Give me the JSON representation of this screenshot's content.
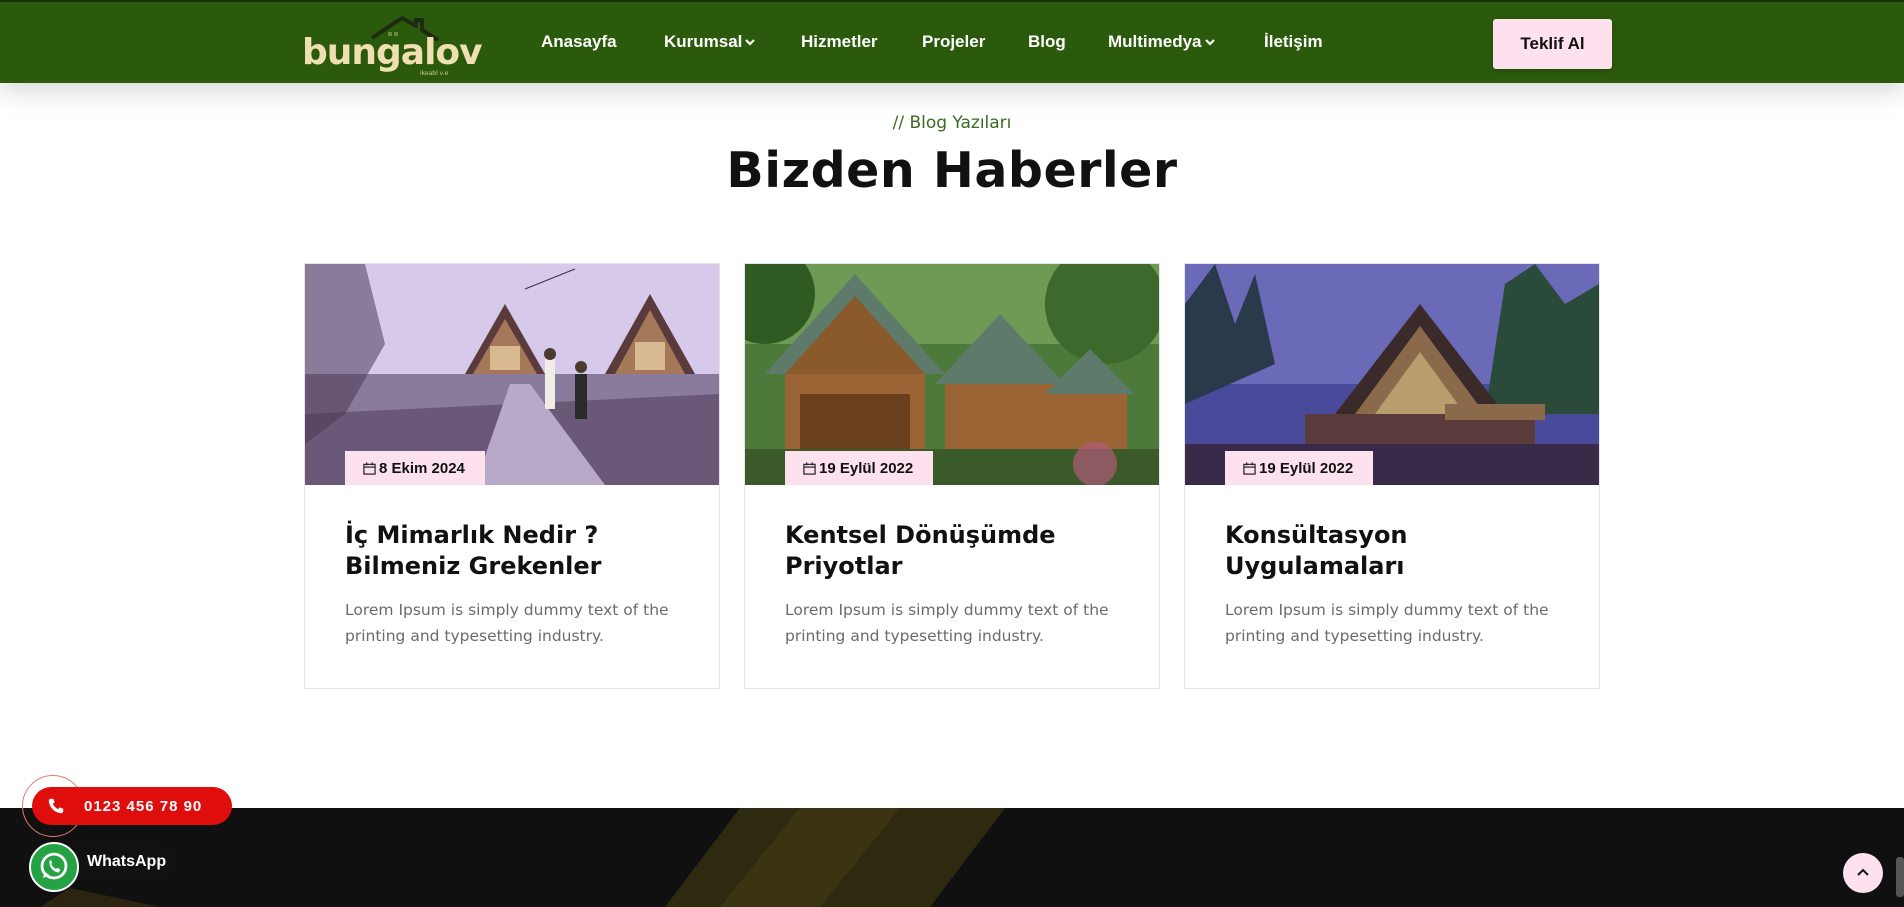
{
  "brand": {
    "name": "bungalov",
    "tagline": "ikeabl v.e"
  },
  "nav": {
    "items": [
      {
        "label": "Anasayfa"
      },
      {
        "label": "Kurumsal",
        "dropdown": true
      },
      {
        "label": "Hizmetler"
      },
      {
        "label": "Projeler"
      },
      {
        "label": "Blog"
      },
      {
        "label": "Multimedya",
        "dropdown": true
      },
      {
        "label": "İletişim"
      }
    ],
    "cta_label": "Teklif Al"
  },
  "section": {
    "subtitle": "// Blog Yazıları",
    "title": "Bizden Haberler"
  },
  "posts": [
    {
      "date": "8 Ekim 2024",
      "title": "İç Mimarlık Nedir ? Bilmeniz Grekenler",
      "excerpt": "Lorem Ipsum is simply dummy text of the printing and typesetting industry.",
      "image": "couple-walking-between-a-frame-cabins"
    },
    {
      "date": "19 Eylül 2022",
      "title": "Kentsel Dönüşümde Priyotlar",
      "excerpt": "Lorem Ipsum is simply dummy text of the printing and typesetting industry.",
      "image": "log-cabins-in-forest"
    },
    {
      "date": "19 Eylül 2022",
      "title": "Konsültasyon Uygulamaları",
      "excerpt": "Lorem Ipsum is simply dummy text of the printing and typesetting industry.",
      "image": "glass-a-frame-house-at-dusk"
    }
  ],
  "floating": {
    "phone": "0123 456 78 90",
    "whatsapp": "WhatsApp"
  },
  "colors": {
    "header_bg": "#2b5a0c",
    "accent_pink": "#fde1ef",
    "phone_red": "#e00d0d",
    "whatsapp_green": "#25a244",
    "footer_bg": "#101010",
    "subtitle_green": "#3c6a20"
  },
  "icons": {
    "calendar": "calendar-icon",
    "phone": "phone-icon",
    "whatsapp": "whatsapp-icon",
    "scroll_top": "arrow-up-icon",
    "dropdown": "chevron-down-icon"
  }
}
